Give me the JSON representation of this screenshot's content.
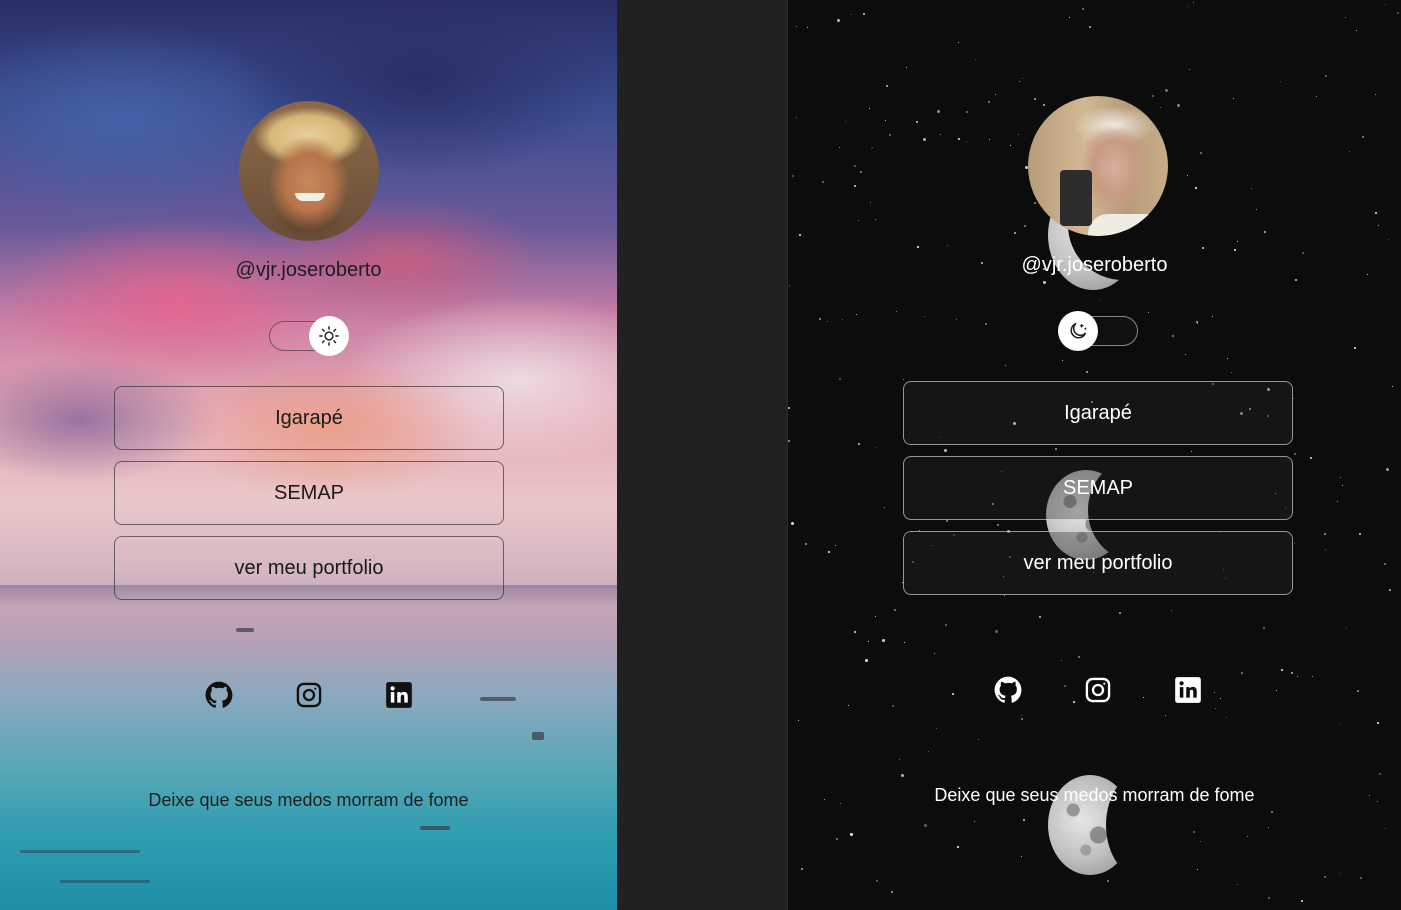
{
  "light": {
    "username": "@vjr.joseroberto",
    "theme_toggle_icon": "sun-icon",
    "links": [
      {
        "label": "Igarapé"
      },
      {
        "label": "SEMAP"
      },
      {
        "label": "ver meu portfolio"
      }
    ],
    "socials": [
      "github-icon",
      "instagram-icon",
      "linkedin-icon"
    ],
    "quote": "Deixe que seus medos morram de fome"
  },
  "dark": {
    "username": "@vjr.joseroberto",
    "theme_toggle_icon": "moon-icon",
    "links": [
      {
        "label": "Igarapé"
      },
      {
        "label": "SEMAP"
      },
      {
        "label": "ver meu portfolio"
      }
    ],
    "socials": [
      "github-icon",
      "instagram-icon",
      "linkedin-icon"
    ],
    "quote": "Deixe que seus medos morram de fome"
  },
  "colors": {
    "light_text": "#1e1e1e",
    "dark_text": "#ffffff",
    "gap_background": "#212121",
    "dark_background": "#0c0c0d"
  }
}
